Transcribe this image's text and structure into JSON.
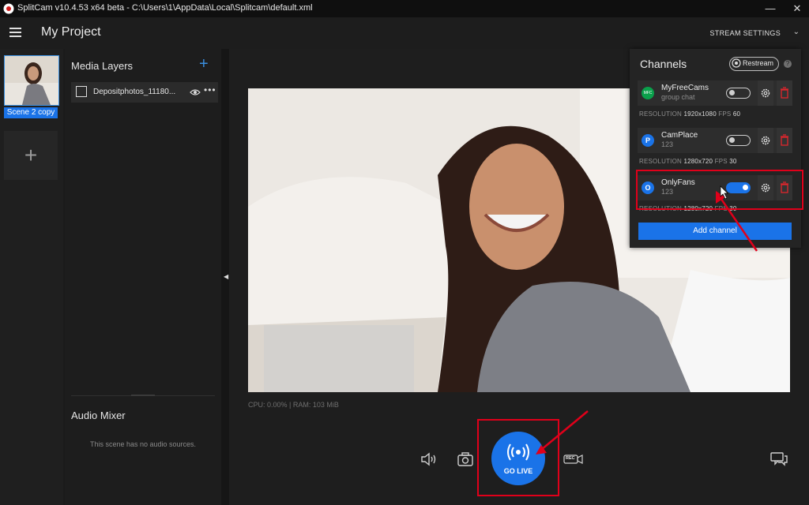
{
  "titlebar": {
    "title": "SplitCam v10.4.53 x64 beta - C:\\Users\\1\\AppData\\Local\\Splitcam\\default.xml",
    "minimize": "—",
    "close": "✕"
  },
  "header": {
    "project_title": "My Project",
    "stream_settings": "STREAM SETTINGS",
    "chevron": "⌄"
  },
  "scenes": {
    "items": [
      {
        "label": "Scene 2 copy",
        "selected": true
      }
    ],
    "add_label": "+"
  },
  "media_layers": {
    "title": "Media Layers",
    "add": "+",
    "items": [
      {
        "name": "Depositphotos_11180...",
        "more": "•••"
      }
    ]
  },
  "audio_mixer": {
    "title": "Audio Mixer",
    "empty_message": "This scene has no audio sources."
  },
  "stats": {
    "text": "CPU: 0.00% | RAM: 103 MiB"
  },
  "toolbar": {
    "go_live_label": "GO LIVE",
    "rec_label": "REC"
  },
  "channels_panel": {
    "title": "Channels",
    "restream_label": "Restream",
    "help": "?",
    "add_channel": "Add channel",
    "channels": [
      {
        "name": "MyFreeCams",
        "sub": "group chat",
        "enabled": false,
        "resolution_label": "RESOLUTION",
        "resolution": "1920x1080",
        "fps_label": "FPS",
        "fps": "60",
        "logo_color": "#0aa04b",
        "logo_text": "MFC"
      },
      {
        "name": "CamPlace",
        "sub": "123",
        "enabled": false,
        "resolution_label": "RESOLUTION",
        "resolution": "1280x720",
        "fps_label": "FPS",
        "fps": "30",
        "logo_color": "#1a73e8",
        "logo_text": "P"
      },
      {
        "name": "OnlyFans",
        "sub": "123",
        "enabled": true,
        "resolution_label": "RESOLUTION",
        "resolution": "1280x720",
        "fps_label": "FPS",
        "fps": "30",
        "logo_color": "#1a73e8",
        "logo_text": "O"
      }
    ]
  },
  "colors": {
    "accent": "#1a73e8",
    "highlight": "#e0001a",
    "delete": "#e0262d"
  },
  "icons": {
    "menu": "hamburger-icon",
    "volume": "speaker-icon",
    "screenshot": "camera-icon",
    "live": "broadcast-icon",
    "rec": "record-icon",
    "chat": "chat-icon",
    "gear": "gear-icon",
    "delete": "trash-icon",
    "visibility": "eye-icon"
  }
}
